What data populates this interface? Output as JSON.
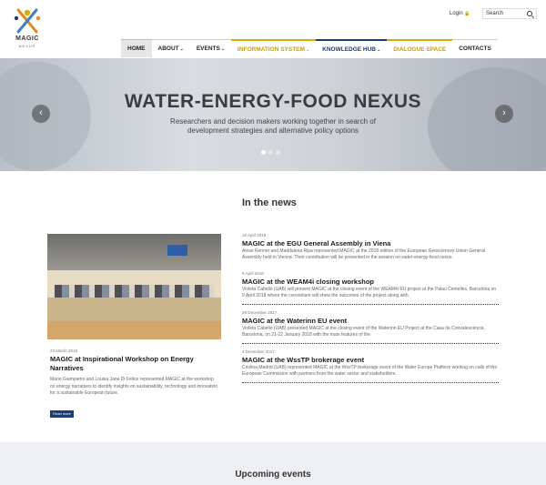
{
  "brand": {
    "name": "MAGIC",
    "tagline": "NEXUS",
    "colors": {
      "navy": "#1c3d70",
      "gold": "#d6b000",
      "orange": "#e58a1f",
      "blue": "#3e7fc1"
    }
  },
  "header": {
    "login_label": "Login",
    "login_icon": "lock-icon",
    "search_placeholder": "Search",
    "nav": [
      {
        "label": "HOME",
        "dropdown": false
      },
      {
        "label": "ABOUT",
        "dropdown": true
      },
      {
        "label": "EVENTS",
        "dropdown": true
      },
      {
        "label": "INFORMATION SYSTEM",
        "dropdown": true
      },
      {
        "label": "KNOWLEDGE HUB",
        "dropdown": true
      },
      {
        "label": "DIALOGUE SPACE",
        "dropdown": false
      },
      {
        "label": "CONTACTS",
        "dropdown": false
      }
    ]
  },
  "hero": {
    "title": "WATER-ENERGY-FOOD NEXUS",
    "subtitle": "Researchers and decision makers working together in search of development strategies and alternative policy options",
    "slide_count": 3,
    "active_slide": 1
  },
  "news": {
    "heading": "In the news",
    "featured": {
      "date": "23 March 2018",
      "title": "MAGIC at Inspirational Workshop on Energy Narratives",
      "text": "Mario Giampietro and Louisa Jane Di Felice represented MAGIC at the workshop on energy narratives to identify insights on sustainability, technology and innovation for a sustainable European future.",
      "button": "Read more"
    },
    "items": [
      {
        "date": "16 April 2018",
        "title": "MAGIC at the EGU General Assembly in Viena",
        "text": "Ansel Renner and Maddalena Ripa represented MAGIC at the 2018 edition of the European Geosciences Union General Assembly held in Vienna. Their contribution will be presented in the session on water-energy-food nexus."
      },
      {
        "date": "5 April 2018",
        "title": "MAGIC at the WEAM4i closing workshop",
        "text": "Violeta Cabello (UAB) will present MAGIC at the closing event of the WEAM4i EU project at the Palau Centelles, Barcelona on 9 April 2018 where the consortium will show the outcomes of the project along with"
      },
      {
        "date": "29 December 2017",
        "title": "MAGIC at the Waterinn EU event",
        "text": "Violeta Cabello (UAB) presented MAGIC at the closing event of the Waterinn EU Project at the Casa de Convalescència, Barcelona, on 21-22 January 2018 with the main features of the"
      },
      {
        "date": "4 December 2017",
        "title": "MAGIC at the WssTP brokerage event",
        "text": "Cristina Madrid (UAB) represented MAGIC at the WssTP brokerage event of the Water Europe Platform working on calls of the European Commission with partners from the water sector and stakeholders."
      }
    ]
  },
  "upcoming": {
    "heading": "Upcoming events"
  }
}
